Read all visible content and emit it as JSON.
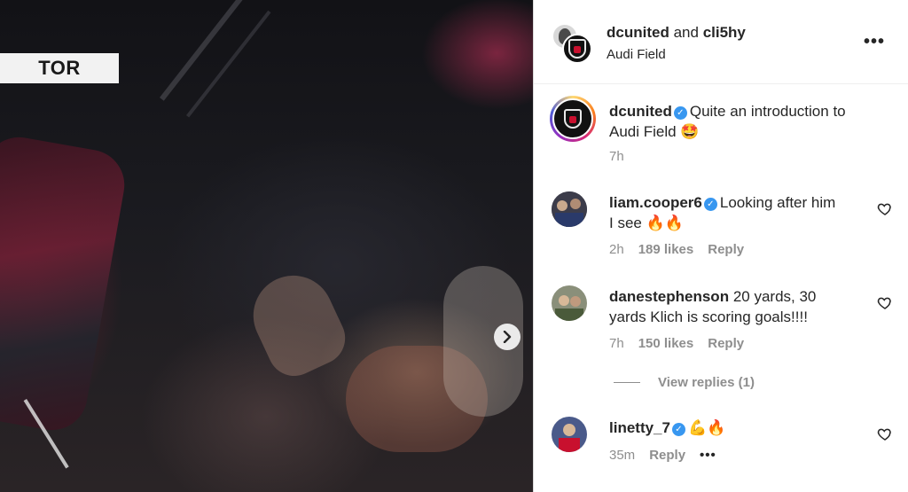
{
  "media": {
    "score_tag": "TOR",
    "next_icon": "chevron-right-icon"
  },
  "header": {
    "user1": "dcunited",
    "conjunction": "and",
    "user2": "cli5hy",
    "location": "Audi Field",
    "more_icon": "more-horizontal-icon"
  },
  "caption": {
    "username": "dcunited",
    "text_line1": "Quite an introduction to",
    "text_line2": "Audi Field 🤩",
    "time": "7h"
  },
  "comments": [
    {
      "username": "liam.cooper6",
      "verified": true,
      "text_line1": "Looking after him",
      "text_line2": "I see 🔥🔥",
      "time": "2h",
      "likes": "189 likes",
      "reply": "Reply"
    },
    {
      "username": "danestephenson",
      "verified": false,
      "text_line1": "20 yards, 30",
      "text_line2": "yards Klich is scoring goals!!!!",
      "time": "7h",
      "likes": "150 likes",
      "reply": "Reply",
      "view_replies": "View replies (1)"
    },
    {
      "username": "linetty_7",
      "verified": true,
      "text_line1": "💪🔥",
      "time": "35m",
      "reply": "Reply",
      "more": "•••"
    }
  ],
  "colors": {
    "verified_blue": "#3897f0",
    "secondary_text": "#8e8e8e",
    "primary_text": "#262626",
    "brand_red": "#c8102e"
  }
}
